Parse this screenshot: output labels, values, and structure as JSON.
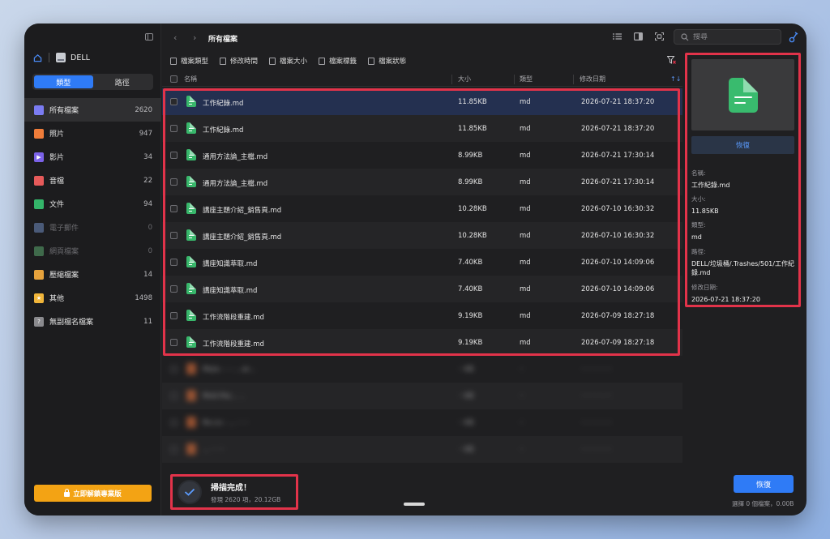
{
  "sidebar": {
    "drive_name": "DELL",
    "tabs": [
      {
        "label": "類型",
        "active": true
      },
      {
        "label": "路徑",
        "active": false
      }
    ],
    "items": [
      {
        "label": "所有檔案",
        "count": "2620",
        "icon": "grid-icon",
        "color": "#7b7cf2",
        "active": true
      },
      {
        "label": "照片",
        "count": "947",
        "icon": "photo-icon",
        "color": "#f07d3a"
      },
      {
        "label": "影片",
        "count": "34",
        "icon": "video-icon",
        "color": "#7b62e8"
      },
      {
        "label": "音檔",
        "count": "22",
        "icon": "music-icon",
        "color": "#e65a5a"
      },
      {
        "label": "文件",
        "count": "94",
        "icon": "document-icon",
        "color": "#34b56a"
      },
      {
        "label": "電子郵件",
        "count": "0",
        "icon": "email-icon",
        "color": "#4a5a78",
        "dim": true
      },
      {
        "label": "網頁檔案",
        "count": "0",
        "icon": "web-icon",
        "color": "#3f6a4b",
        "dim": true
      },
      {
        "label": "壓縮檔案",
        "count": "14",
        "icon": "archive-icon",
        "color": "#e6a23c"
      },
      {
        "label": "其他",
        "count": "1498",
        "icon": "other-icon",
        "color": "#f0b53a"
      },
      {
        "label": "無副檔名檔案",
        "count": "11",
        "icon": "unknown-icon",
        "color": "#8a8a8e"
      }
    ],
    "unlock_label": "立即解鎖專業版"
  },
  "topbar": {
    "title": "所有檔案",
    "search_placeholder": "搜尋"
  },
  "filters": [
    "檔案類型",
    "修改時間",
    "檔案大小",
    "檔案標籤",
    "檔案狀態"
  ],
  "table": {
    "headers": {
      "name": "名稱",
      "size": "大小",
      "type": "類型",
      "date": "修改日期"
    },
    "rows": [
      {
        "name": "工作紀錄.md",
        "size": "11.85KB",
        "type": "md",
        "date": "2026-07-21 18:37:20",
        "selected": true
      },
      {
        "name": "工作紀錄.md",
        "size": "11.85KB",
        "type": "md",
        "date": "2026-07-21 18:37:20"
      },
      {
        "name": "通用方法論_主檔.md",
        "size": "8.99KB",
        "type": "md",
        "date": "2026-07-21 17:30:14"
      },
      {
        "name": "通用方法論_主檔.md",
        "size": "8.99KB",
        "type": "md",
        "date": "2026-07-21 17:30:14"
      },
      {
        "name": "講座主題介紹_銷售頁.md",
        "size": "10.28KB",
        "type": "md",
        "date": "2026-07-10 16:30:32"
      },
      {
        "name": "講座主題介紹_銷售頁.md",
        "size": "10.28KB",
        "type": "md",
        "date": "2026-07-10 16:30:32"
      },
      {
        "name": "講座知識萃取.md",
        "size": "7.40KB",
        "type": "md",
        "date": "2026-07-10 14:09:06"
      },
      {
        "name": "講座知識萃取.md",
        "size": "7.40KB",
        "type": "md",
        "date": "2026-07-10 14:09:06"
      },
      {
        "name": "工作流階段重建.md",
        "size": "9.19KB",
        "type": "md",
        "date": "2026-07-09 18:27:18"
      },
      {
        "name": "工作流階段重建.md",
        "size": "9.19KB",
        "type": "md",
        "date": "2026-07-09 18:27:18"
      }
    ],
    "blurred_rows": [
      {
        "name": "Ma/a - - - ..-ar...",
        "size": "···KB",
        "type": "··",
        "date": "·· ·· ·· ·· ··"
      },
      {
        "name": "MoA-Pac... ..",
        "size": "···KB",
        "type": "··",
        "date": "·· ·· ·· ·· ··"
      },
      {
        "name": "Ro-co - ... ·· ··",
        "size": "···KB",
        "type": "··",
        "date": "·· ·· ·· ·· ··"
      },
      {
        "name": "... ·· ···",
        "size": "···KB",
        "type": "··",
        "date": "·· ·· ·· ·· ··"
      }
    ]
  },
  "scan": {
    "title": "掃描完成！",
    "subtitle": "發現 2620 項，20.12GB"
  },
  "preview": {
    "recover_label": "恢復",
    "name_key": "名稱:",
    "name_val": "工作紀錄.md",
    "size_key": "大小:",
    "size_val": "11.85KB",
    "type_key": "類型:",
    "type_val": "md",
    "path_key": "路徑:",
    "path_val": "DELL/垃圾桶/.Trashes/501/工作紀錄.md",
    "date_key": "修改日期:",
    "date_val": "2026-07-21 18:37:20"
  },
  "footer": {
    "recover_label": "恢復",
    "selected_info": "選擇 0 個檔案，0.00B"
  }
}
